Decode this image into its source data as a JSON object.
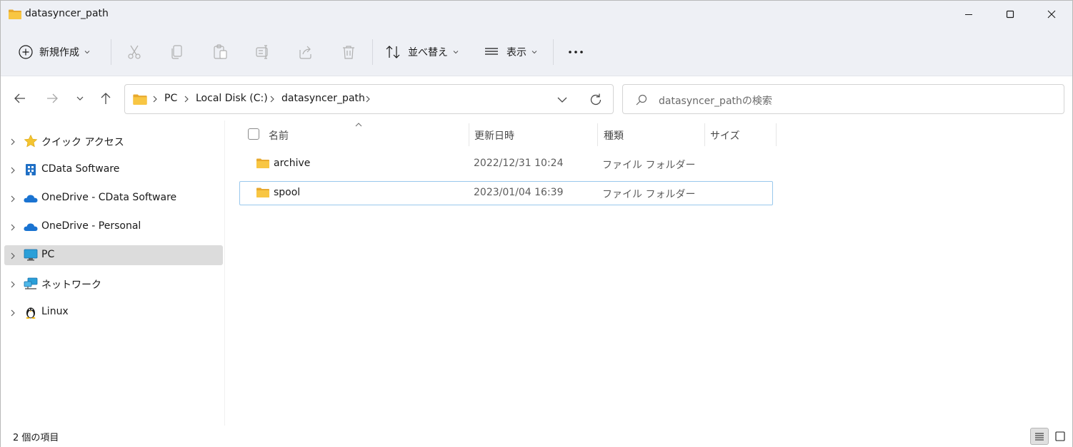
{
  "window": {
    "title": "datasyncer_path"
  },
  "toolbar": {
    "new_label": "新規作成",
    "sort_label": "並べ替え",
    "view_label": "表示"
  },
  "address": {
    "crumbs": [
      "PC",
      "Local Disk (C:)",
      "datasyncer_path"
    ],
    "search_placeholder": "datasyncer_pathの検索"
  },
  "sidebar": {
    "items": [
      {
        "label": "クイック アクセス",
        "icon": "star-icon"
      },
      {
        "label": "CData Software",
        "icon": "building-icon"
      },
      {
        "label": "OneDrive - CData Software",
        "icon": "cloud-icon"
      },
      {
        "label": "OneDrive - Personal",
        "icon": "cloud-icon"
      },
      {
        "label": "PC",
        "icon": "monitor-icon",
        "selected": true
      },
      {
        "label": "ネットワーク",
        "icon": "network-icon"
      },
      {
        "label": "Linux",
        "icon": "penguin-icon"
      }
    ]
  },
  "columns": {
    "name": "名前",
    "date": "更新日時",
    "type": "種類",
    "size": "サイズ"
  },
  "files": [
    {
      "name": "archive",
      "date": "2022/12/31 10:24",
      "type": "ファイル フォルダー",
      "size": ""
    },
    {
      "name": "spool",
      "date": "2023/01/04 16:39",
      "type": "ファイル フォルダー",
      "size": ""
    }
  ],
  "status": {
    "count_text": "2 個の項目"
  },
  "colors": {
    "folder": "#f8c643",
    "accent": "#0067c0",
    "selection_border": "#99c8ed"
  }
}
